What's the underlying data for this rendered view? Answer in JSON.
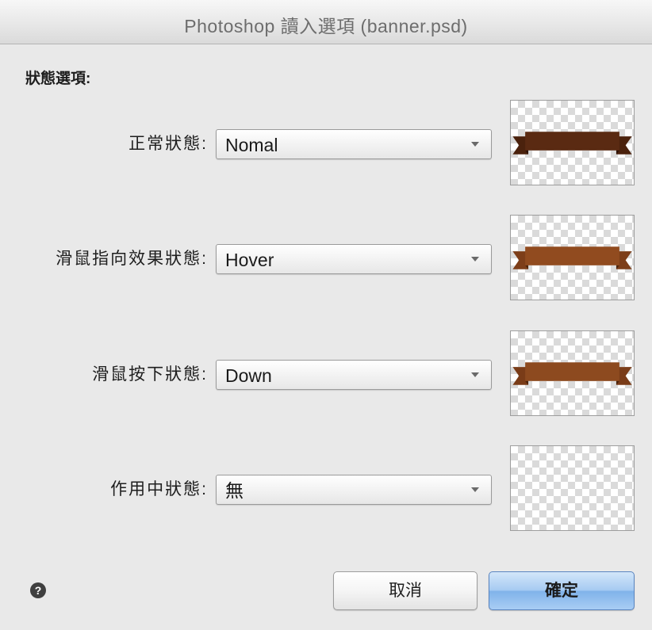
{
  "window": {
    "title": "Photoshop 讀入選項 (banner.psd)"
  },
  "options": {
    "section_title": "狀態選項:",
    "states": [
      {
        "label": "正常狀態:",
        "value": "Nomal",
        "preview": {
          "banner_color": "#5a2a12",
          "tail_color": "#4b220d",
          "fold_color": "#2d1207"
        }
      },
      {
        "label": "滑鼠指向效果狀態:",
        "value": "Hover",
        "preview": {
          "banner_color": "#914b1f",
          "tail_color": "#7d3e19",
          "fold_color": "#4d250d"
        }
      },
      {
        "label": "滑鼠按下狀態:",
        "value": "Down",
        "preview": {
          "banner_color": "#8d4a1f",
          "tail_color": "#7a3c18",
          "fold_color": "#4a230c"
        }
      },
      {
        "label": "作用中狀態:",
        "value": "無",
        "preview": {}
      }
    ]
  },
  "icons": {
    "dropdown": "dropdown-arrow-icon",
    "help": "help-icon"
  },
  "footer": {
    "help_glyph": "?",
    "cancel_label": "取消",
    "ok_label": "確定"
  },
  "colors": {
    "default_button": "#80b3ea",
    "checker_light": "#ffffff",
    "checker_dark": "#dadada"
  }
}
